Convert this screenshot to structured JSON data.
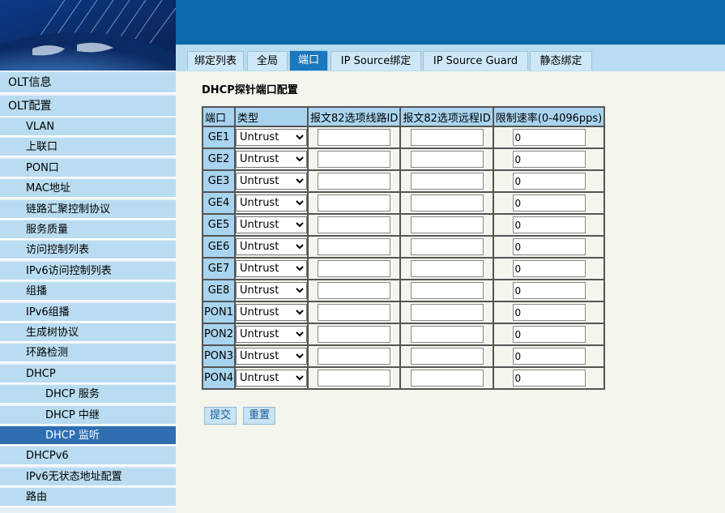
{
  "tabs": [
    {
      "label": "绑定列表",
      "active": false
    },
    {
      "label": "全局",
      "active": false
    },
    {
      "label": "端口",
      "active": true
    },
    {
      "label": "IP Source绑定",
      "active": false
    },
    {
      "label": "IP Source Guard",
      "active": false
    },
    {
      "label": "静态绑定",
      "active": false
    }
  ],
  "sidebar": {
    "items": [
      {
        "label": "OLT信息",
        "level": 0,
        "active": false
      },
      {
        "label": "OLT配置",
        "level": 0,
        "active": false
      },
      {
        "label": "VLAN",
        "level": 1,
        "active": false
      },
      {
        "label": "上联口",
        "level": 1,
        "active": false
      },
      {
        "label": "PON口",
        "level": 1,
        "active": false
      },
      {
        "label": "MAC地址",
        "level": 1,
        "active": false
      },
      {
        "label": "链路汇聚控制协议",
        "level": 1,
        "active": false
      },
      {
        "label": "服务质量",
        "level": 1,
        "active": false
      },
      {
        "label": "访问控制列表",
        "level": 1,
        "active": false
      },
      {
        "label": "IPv6访问控制列表",
        "level": 1,
        "active": false
      },
      {
        "label": "组播",
        "level": 1,
        "active": false
      },
      {
        "label": "IPv6组播",
        "level": 1,
        "active": false
      },
      {
        "label": "生成树协议",
        "level": 1,
        "active": false
      },
      {
        "label": "环路检测",
        "level": 1,
        "active": false
      },
      {
        "label": "DHCP",
        "level": 1,
        "active": false
      },
      {
        "label": "DHCP 服务",
        "level": 2,
        "active": false
      },
      {
        "label": "DHCP 中继",
        "level": 2,
        "active": false
      },
      {
        "label": "DHCP 监听",
        "level": 2,
        "active": true
      },
      {
        "label": "DHCPv6",
        "level": 1,
        "active": false
      },
      {
        "label": "IPv6无状态地址配置",
        "level": 1,
        "active": false
      },
      {
        "label": "路由",
        "level": 1,
        "active": false
      }
    ]
  },
  "main": {
    "title": "DHCP探针端口配置",
    "columns": [
      "端口",
      "类型",
      "报文82选项线路ID",
      "报文82选项远程ID",
      "限制速率(0-4096pps)"
    ],
    "rows": [
      {
        "port": "GE1",
        "type": "Untrust",
        "circuit_id": "",
        "remote_id": "",
        "rate": "0"
      },
      {
        "port": "GE2",
        "type": "Untrust",
        "circuit_id": "",
        "remote_id": "",
        "rate": "0"
      },
      {
        "port": "GE3",
        "type": "Untrust",
        "circuit_id": "",
        "remote_id": "",
        "rate": "0"
      },
      {
        "port": "GE4",
        "type": "Untrust",
        "circuit_id": "",
        "remote_id": "",
        "rate": "0"
      },
      {
        "port": "GE5",
        "type": "Untrust",
        "circuit_id": "",
        "remote_id": "",
        "rate": "0"
      },
      {
        "port": "GE6",
        "type": "Untrust",
        "circuit_id": "",
        "remote_id": "",
        "rate": "0"
      },
      {
        "port": "GE7",
        "type": "Untrust",
        "circuit_id": "",
        "remote_id": "",
        "rate": "0"
      },
      {
        "port": "GE8",
        "type": "Untrust",
        "circuit_id": "",
        "remote_id": "",
        "rate": "0"
      },
      {
        "port": "PON1",
        "type": "Untrust",
        "circuit_id": "",
        "remote_id": "",
        "rate": "0"
      },
      {
        "port": "PON2",
        "type": "Untrust",
        "circuit_id": "",
        "remote_id": "",
        "rate": "0"
      },
      {
        "port": "PON3",
        "type": "Untrust",
        "circuit_id": "",
        "remote_id": "",
        "rate": "0"
      },
      {
        "port": "PON4",
        "type": "Untrust",
        "circuit_id": "",
        "remote_id": "",
        "rate": "0"
      }
    ],
    "submit_label": "提交",
    "reset_label": "重置"
  },
  "colors": {
    "header_blue": "#0a6aab",
    "tab_active": "#1a78bd",
    "sidebar_item": "#b9dcf1",
    "sidebar_active": "#2f6fb1",
    "table_header": "#a9d4ef"
  }
}
